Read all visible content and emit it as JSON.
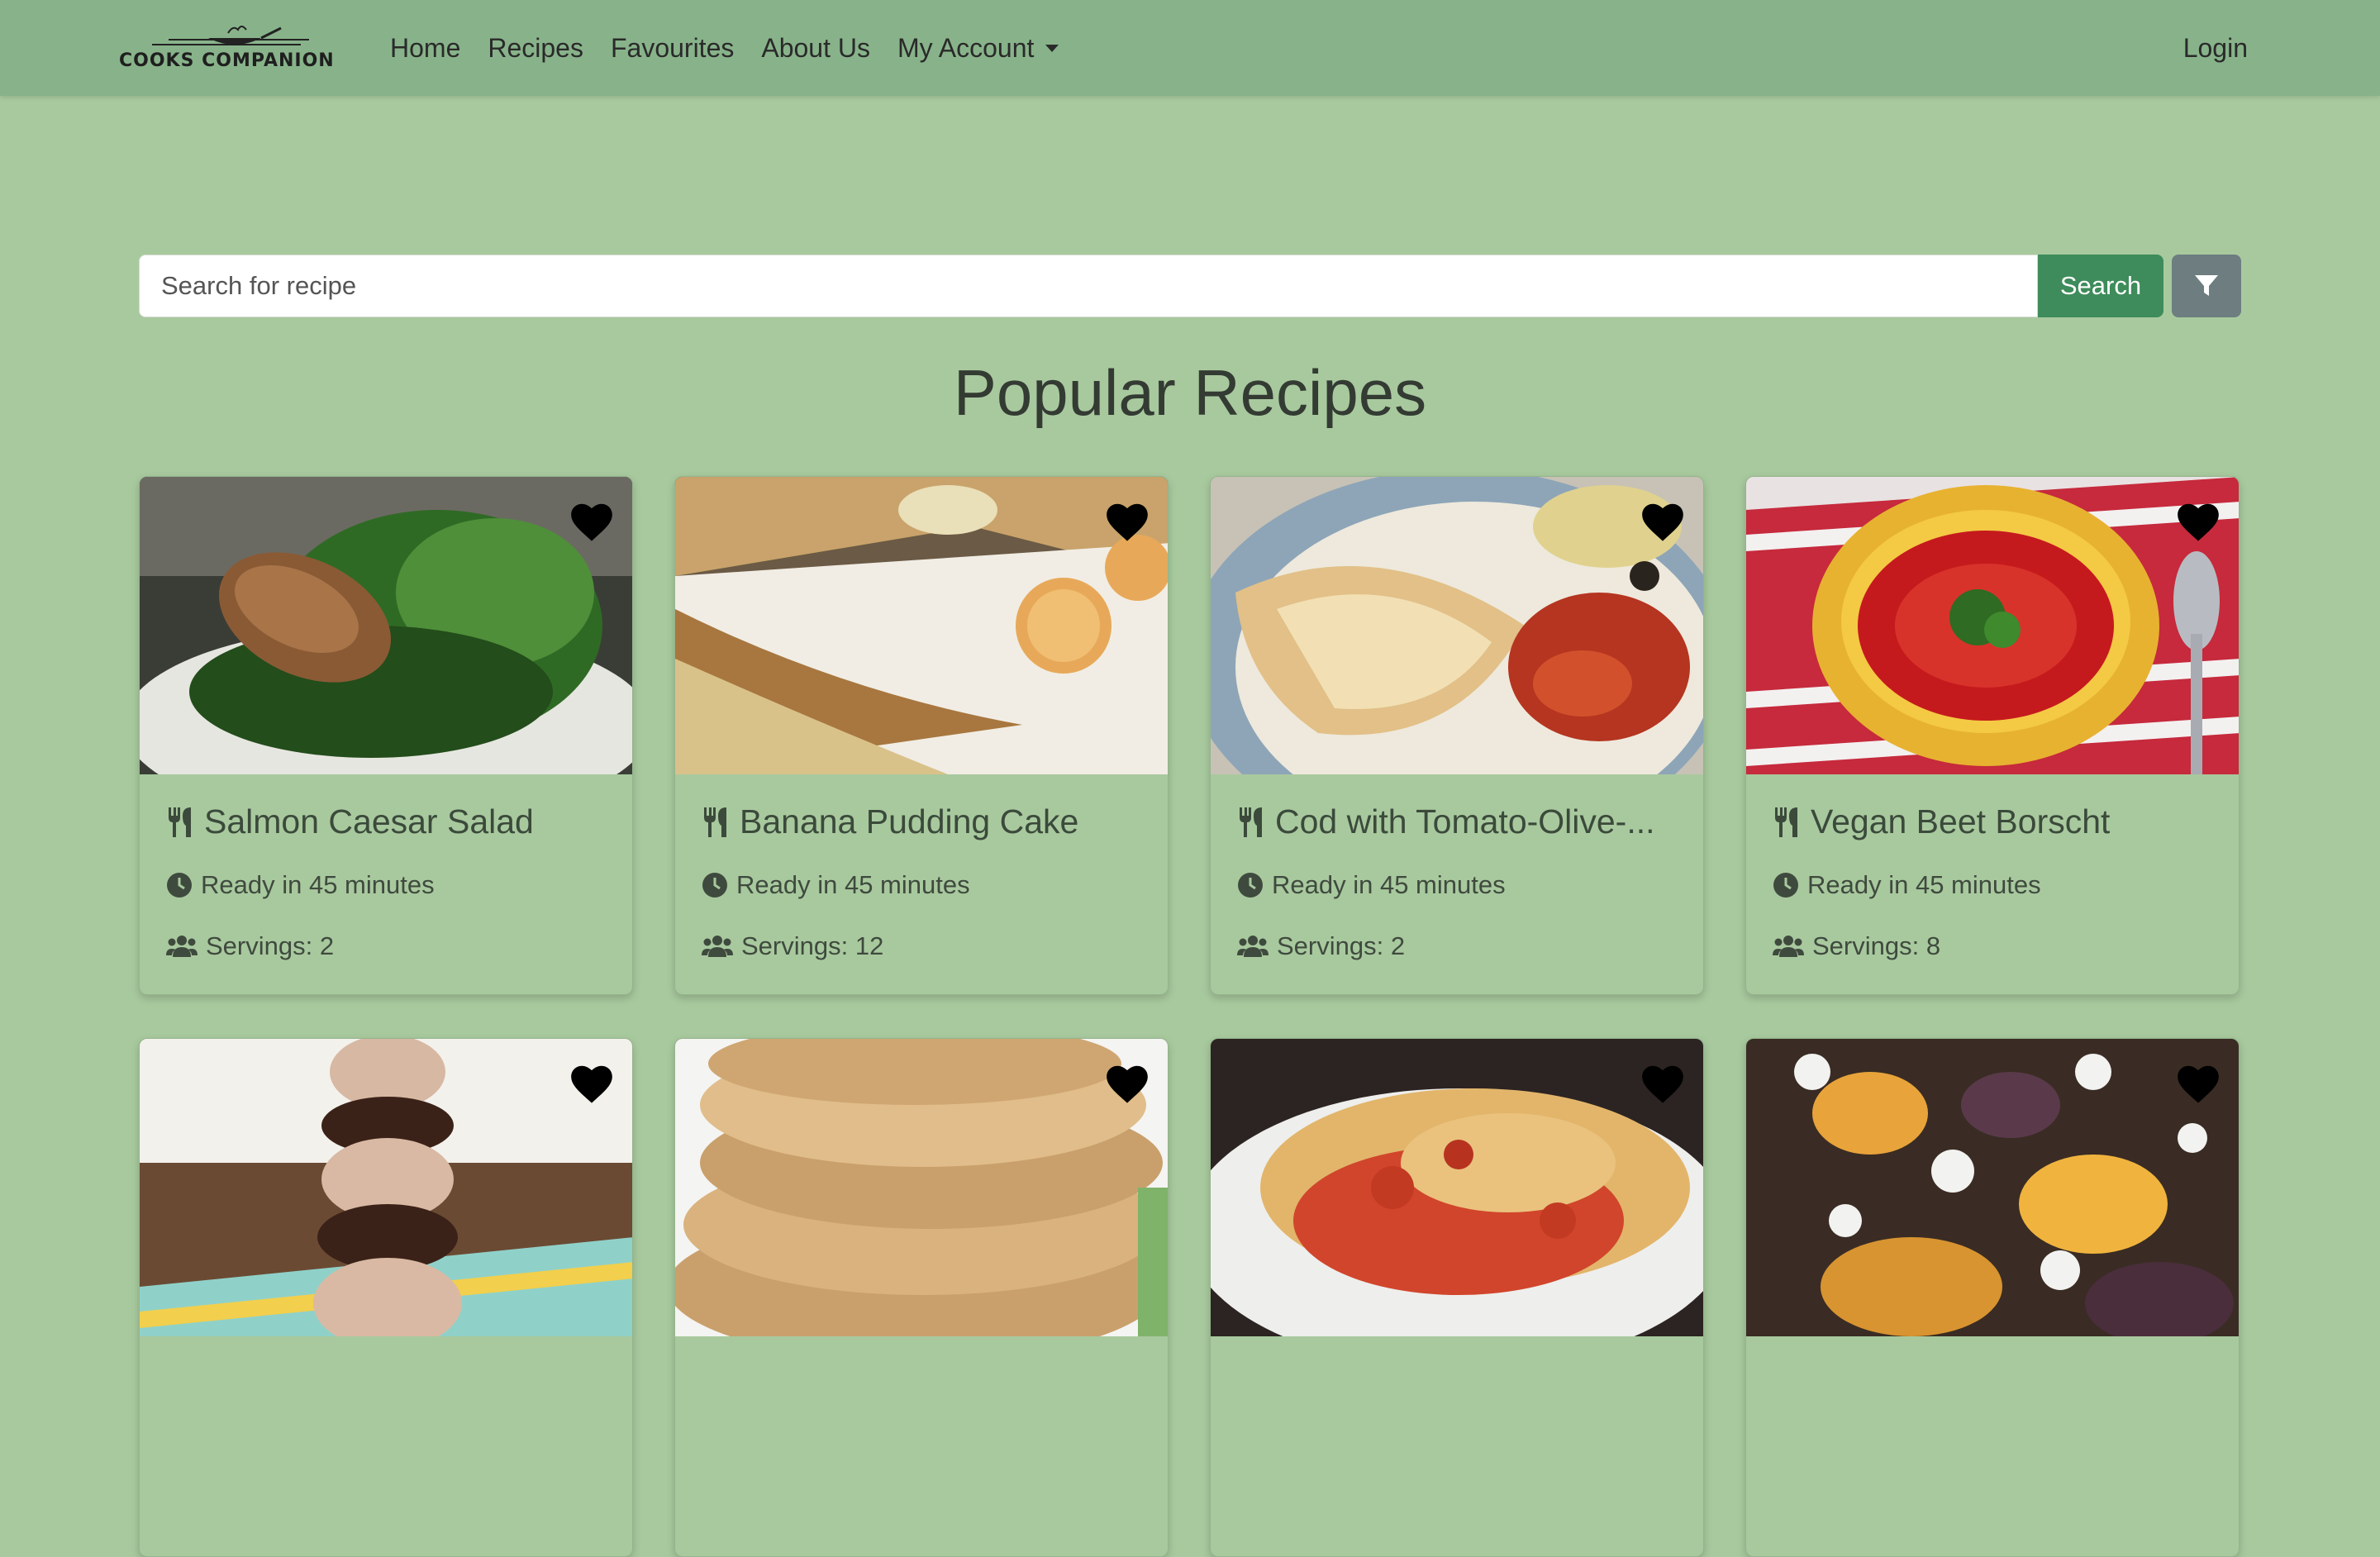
{
  "brand": {
    "name": "COOKS COMPANION"
  },
  "nav": {
    "links": [
      "Home",
      "Recipes",
      "Favourites",
      "About Us"
    ],
    "account_label": "My Account",
    "login_label": "Login"
  },
  "search": {
    "placeholder": "Search for recipe",
    "value": "",
    "button_label": "Search"
  },
  "section": {
    "title": "Popular Recipes"
  },
  "recipes": [
    {
      "title": "Salmon Caesar Salad",
      "ready": "Ready in 45 minutes",
      "servings": "Servings: 2"
    },
    {
      "title": "Banana Pudding Cake",
      "ready": "Ready in 45 minutes",
      "servings": "Servings: 12"
    },
    {
      "title": "Cod with Tomato-Olive-...",
      "ready": "Ready in 45 minutes",
      "servings": "Servings: 2"
    },
    {
      "title": "Vegan Beet Borscht",
      "ready": "Ready in 45 minutes",
      "servings": "Servings: 8"
    }
  ],
  "colors": {
    "page_bg": "#a8c99e",
    "navbar_bg": "#88b38a",
    "search_button": "#3e8c5b",
    "filter_button": "#6d7d80"
  },
  "icons": {
    "recipe_title": "utensils-icon",
    "ready_time": "clock-icon",
    "servings": "users-icon",
    "favourite": "heart-icon",
    "filter": "filter-icon"
  }
}
